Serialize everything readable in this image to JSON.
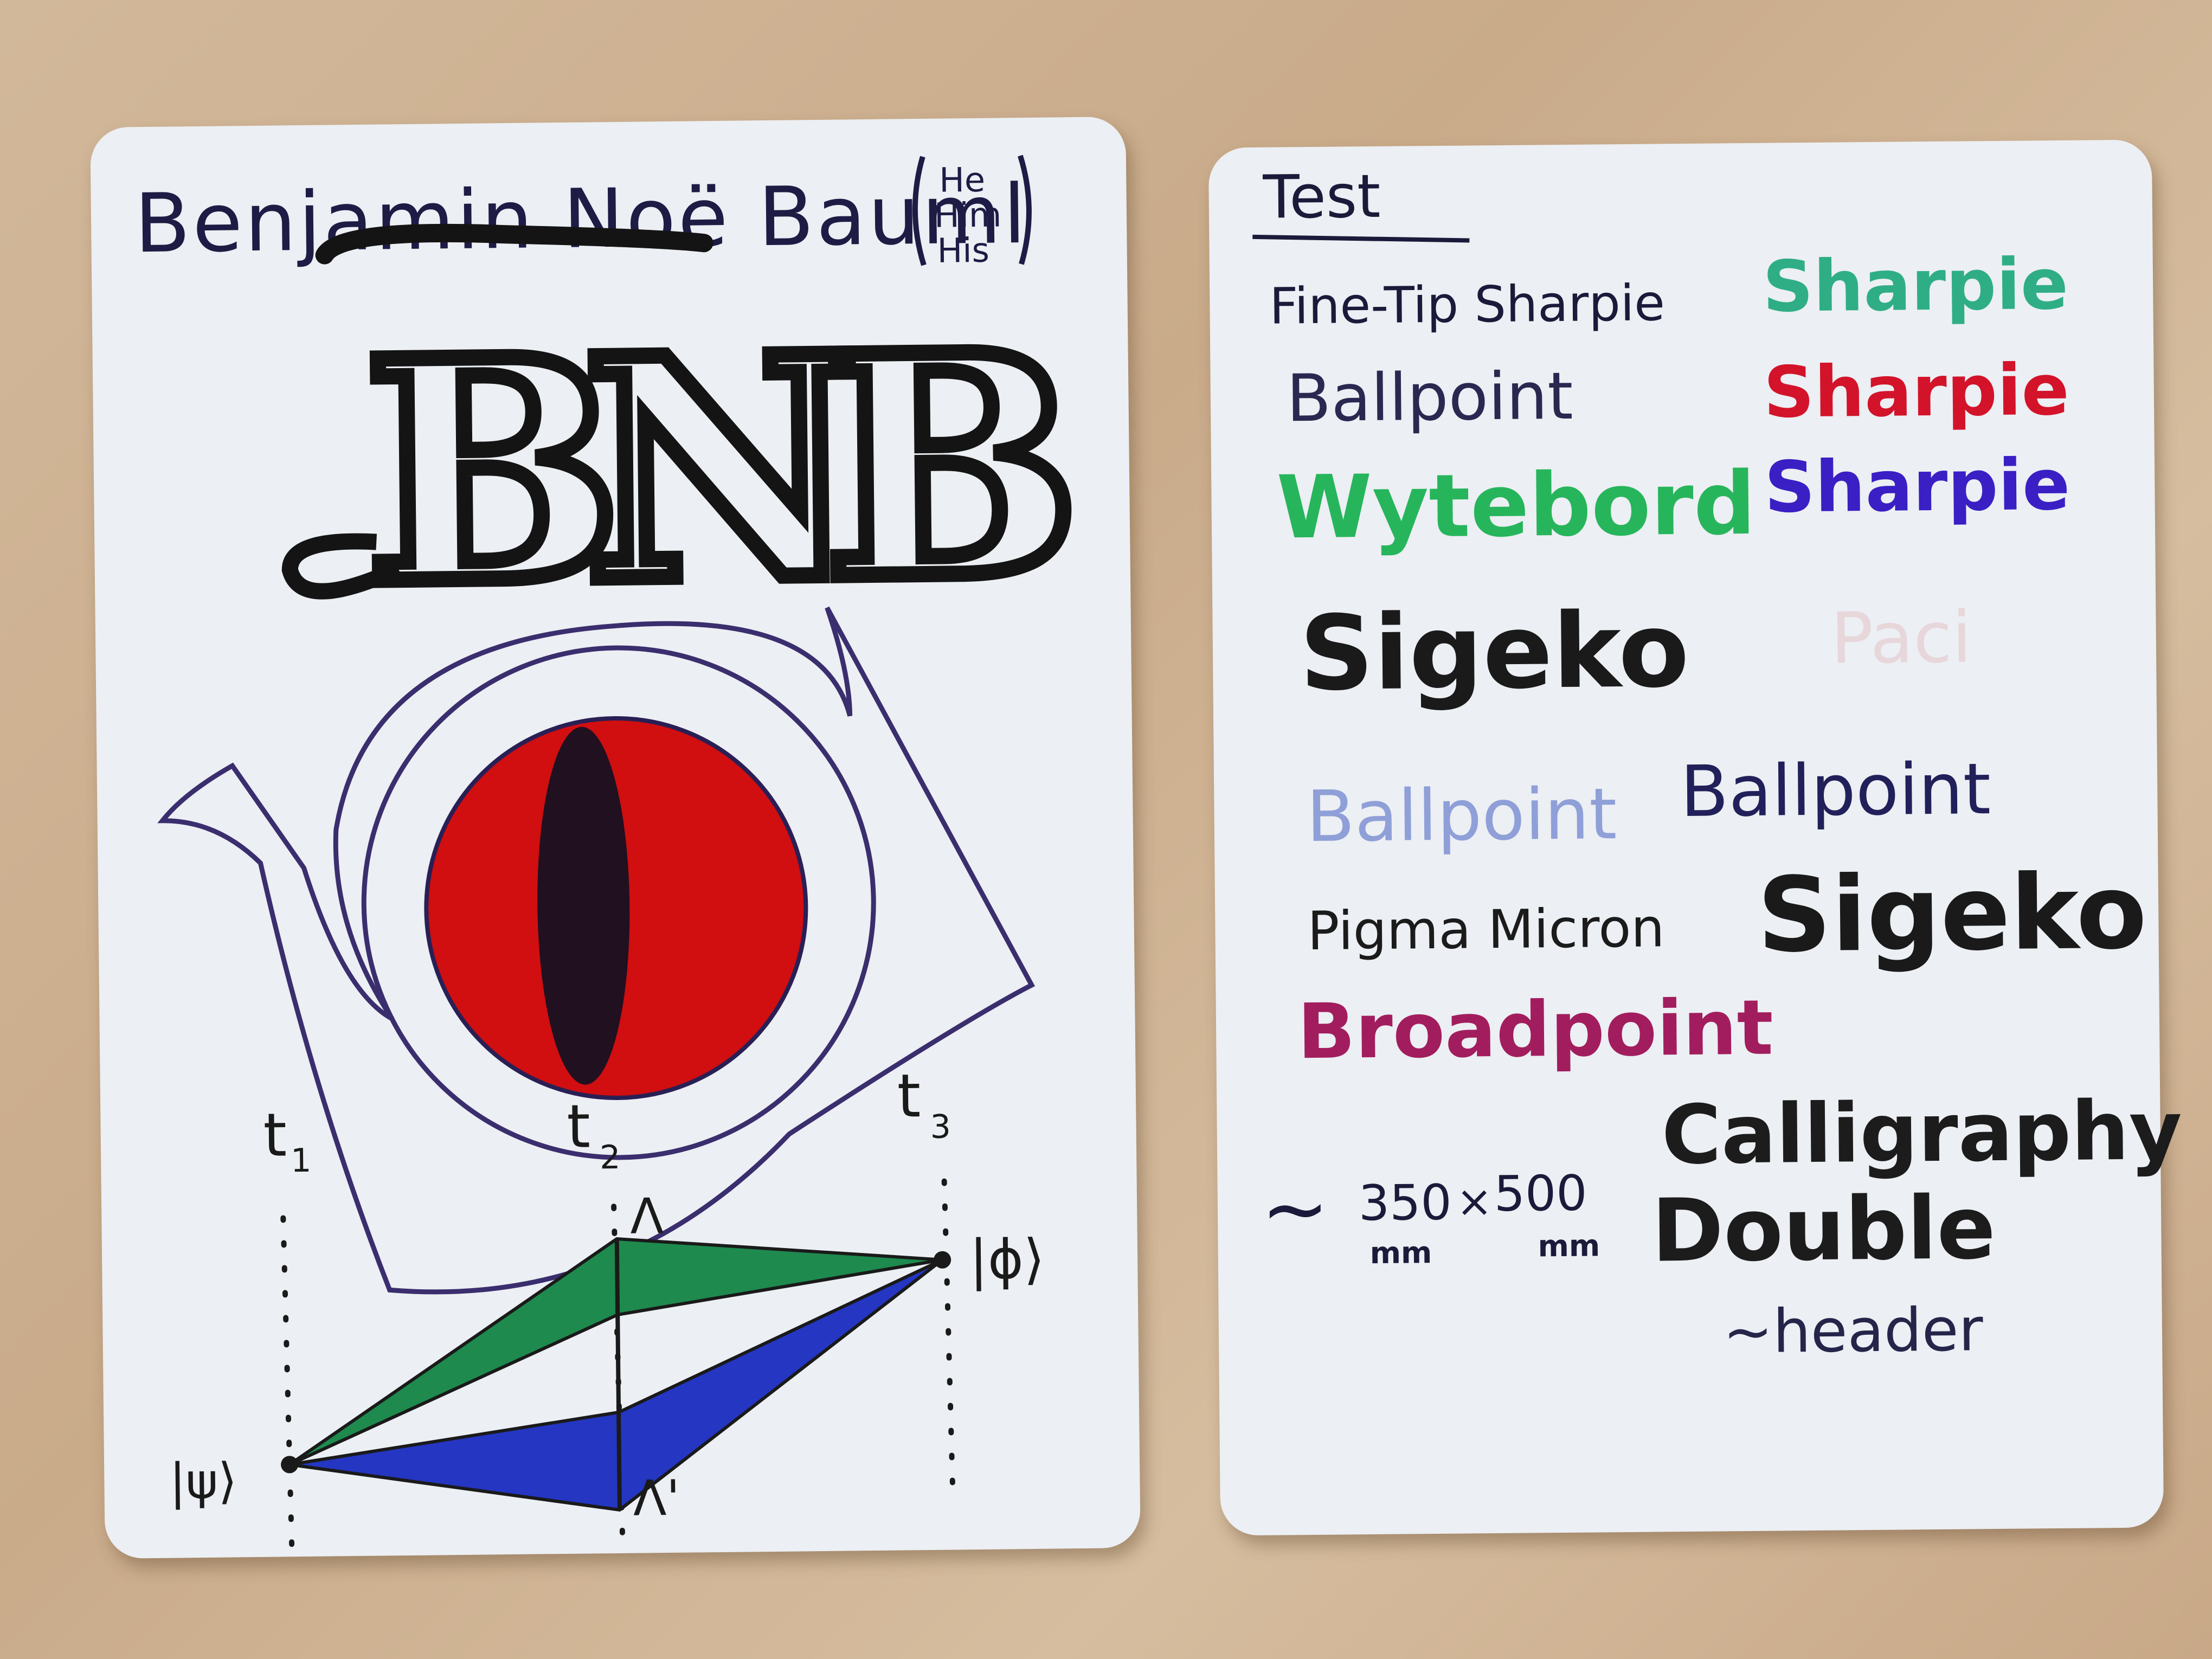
{
  "left_card": {
    "name": "Benjamin Noë Bauml",
    "pronouns": [
      "He",
      "Him",
      "His"
    ],
    "monogram": "BNB",
    "diagram": {
      "times": [
        "t",
        "t",
        "t"
      ],
      "time_subscripts": [
        "1",
        "2",
        "3"
      ],
      "state_start": "|ψ⟩",
      "state_end": "|ϕ⟩",
      "lambda_top": "Λ",
      "lambda_bottom": "Λ'"
    }
  },
  "right_card": {
    "title": "Test",
    "samples": [
      {
        "text": "Fine-Tip Sharpie",
        "color": "#1c1a3a"
      },
      {
        "text": "Sharpie",
        "color": "#2fae86"
      },
      {
        "text": "Ballpoint",
        "color": "#2a2850"
      },
      {
        "text": "Sharpie",
        "color": "#d3132a"
      },
      {
        "text": "Wytebord",
        "color": "#27b55c"
      },
      {
        "text": "Sharpie",
        "color": "#3a1fc4"
      },
      {
        "text": "Sigeko",
        "color": "#1a1a1a"
      },
      {
        "text": "Paci",
        "color": "#e7d6da"
      },
      {
        "text": "Ballpoint",
        "color": "#8f9fd8"
      },
      {
        "text": "Ballpoint",
        "color": "#22205a"
      },
      {
        "text": "Pigma Micron",
        "color": "#1b1b1b"
      },
      {
        "text": "Sigeko",
        "color": "#1a1a1a"
      },
      {
        "text": "Broadpoint",
        "color": "#a21d5e"
      },
      {
        "text": "Calligraphy",
        "color": "#1c1c1c"
      },
      {
        "text": "Double",
        "color": "#1c1c1c"
      },
      {
        "text": "~header",
        "color": "#25254a"
      }
    ],
    "size_note": {
      "tilde": "∼",
      "width": "350",
      "times": "×",
      "height": "500",
      "unit": "mm"
    }
  }
}
